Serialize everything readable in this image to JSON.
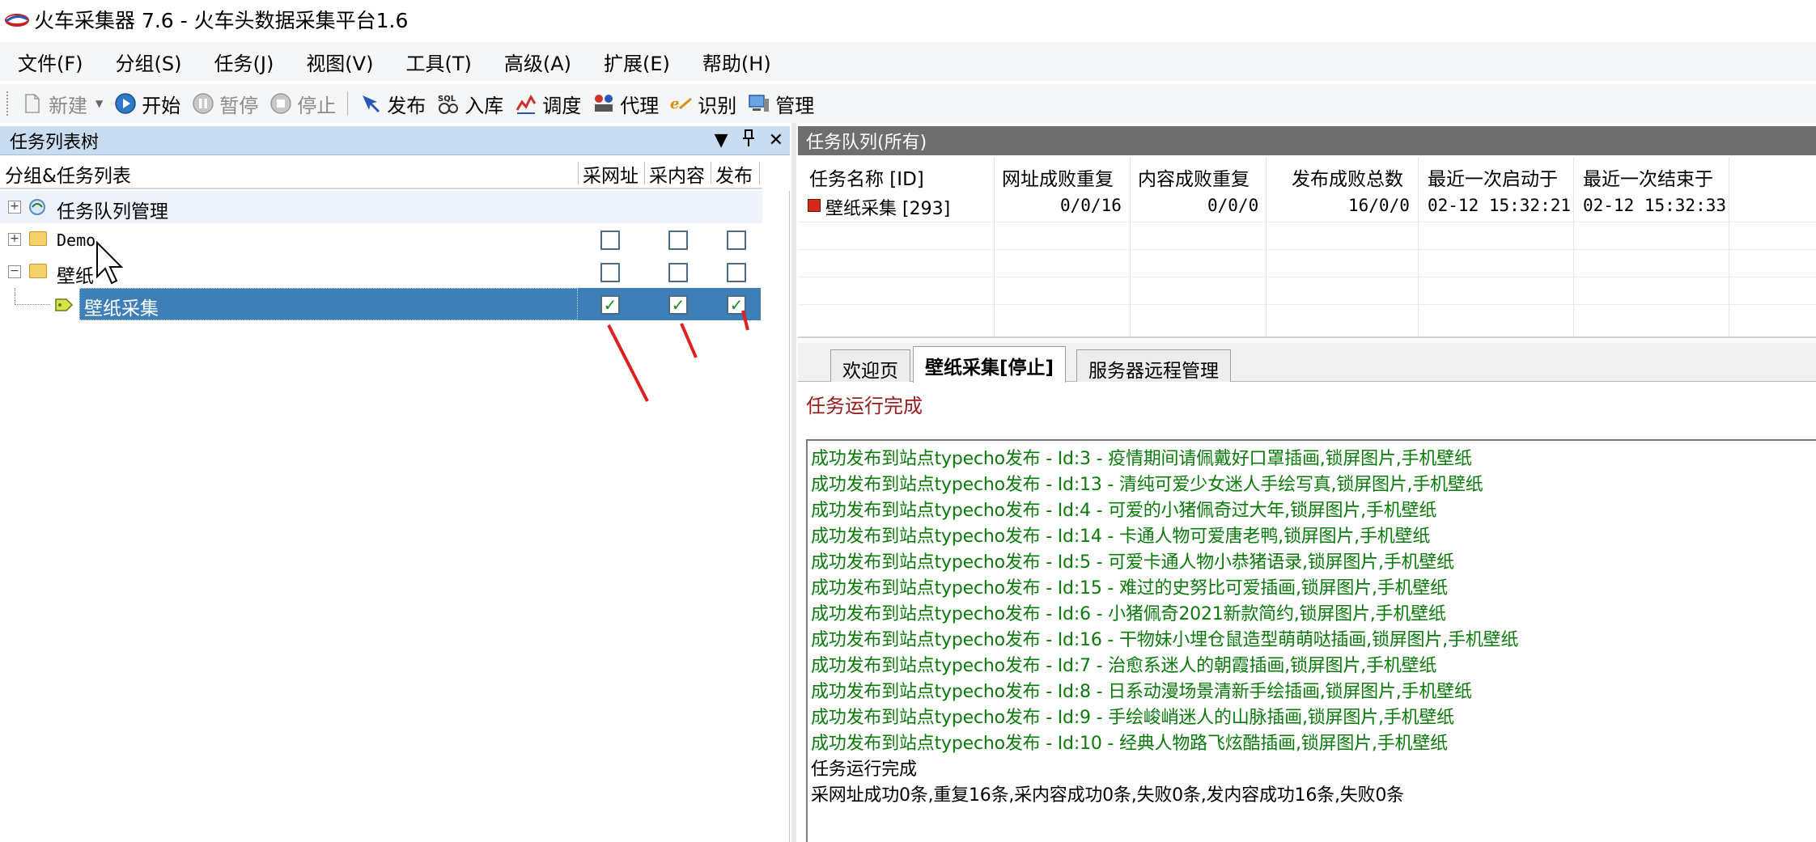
{
  "window": {
    "title": "火车采集器 7.6 - 火车头数据采集平台1.6"
  },
  "menubar": {
    "items": [
      "文件(F)",
      "分组(S)",
      "任务(J)",
      "视图(V)",
      "工具(T)",
      "高级(A)",
      "扩展(E)",
      "帮助(H)"
    ]
  },
  "toolbar": {
    "new_label": "新建",
    "start_label": "开始",
    "pause_label": "暂停",
    "stop_label": "停止",
    "publish_label": "发布",
    "sql_label": "入库",
    "schedule_label": "调度",
    "proxy_label": "代理",
    "recognize_label": "识别",
    "manage_label": "管理"
  },
  "left_panel": {
    "title": "任务列表树",
    "columns": {
      "name": "分组&任务列表",
      "collect_url": "采网址",
      "collect_content": "采内容",
      "publish": "发布"
    },
    "rows": [
      {
        "label": "任务队列管理",
        "checkboxes": null
      },
      {
        "label": "Demo",
        "checkboxes": [
          false,
          false,
          false
        ]
      },
      {
        "label": "壁纸",
        "checkboxes": [
          false,
          false,
          false
        ]
      },
      {
        "label": "壁纸采集",
        "checkboxes": [
          true,
          true,
          true
        ],
        "selected": true
      }
    ]
  },
  "right_panel": {
    "title": "任务队列(所有)",
    "queue_columns": [
      "任务名称 [ID]",
      "网址成败重复",
      "内容成败重复",
      "发布成败总数",
      "最近一次启动于",
      "最近一次结束于"
    ],
    "queue_rows": [
      {
        "name": "壁纸采集 [293]",
        "url_stats": "0/0/16",
        "content_stats": "0/0/0",
        "publish_stats": "16/0/0",
        "last_start": "02-12 15:32:21",
        "last_end": "02-12 15:32:33"
      }
    ],
    "tabs": [
      "欢迎页",
      "壁纸采集[停止]",
      "服务器远程管理"
    ],
    "active_tab": 1,
    "status": "任务运行完成",
    "log_lines": [
      {
        "text": "成功发布到站点typecho发布 - Id:3 - 疫情期间请佩戴好口罩插画,锁屏图片,手机壁纸",
        "color": "green"
      },
      {
        "text": "成功发布到站点typecho发布 - Id:13 - 清纯可爱少女迷人手绘写真,锁屏图片,手机壁纸",
        "color": "green"
      },
      {
        "text": "成功发布到站点typecho发布 - Id:4 - 可爱的小猪佩奇过大年,锁屏图片,手机壁纸",
        "color": "green"
      },
      {
        "text": "成功发布到站点typecho发布 - Id:14 - 卡通人物可爱唐老鸭,锁屏图片,手机壁纸",
        "color": "green"
      },
      {
        "text": "成功发布到站点typecho发布 - Id:5 - 可爱卡通人物小恭猪语录,锁屏图片,手机壁纸",
        "color": "green"
      },
      {
        "text": "成功发布到站点typecho发布 - Id:15 - 难过的史努比可爱插画,锁屏图片,手机壁纸",
        "color": "green"
      },
      {
        "text": "成功发布到站点typecho发布 - Id:6 - 小猪佩奇2021新款简约,锁屏图片,手机壁纸",
        "color": "green"
      },
      {
        "text": "成功发布到站点typecho发布 - Id:16 - 干物妹小埋仓鼠造型萌萌哒插画,锁屏图片,手机壁纸",
        "color": "green"
      },
      {
        "text": "成功发布到站点typecho发布 - Id:7 - 治愈系迷人的朝霞插画,锁屏图片,手机壁纸",
        "color": "green"
      },
      {
        "text": "成功发布到站点typecho发布 - Id:8 - 日系动漫场景清新手绘插画,锁屏图片,手机壁纸",
        "color": "green"
      },
      {
        "text": "成功发布到站点typecho发布 - Id:9 - 手绘峻峭迷人的山脉插画,锁屏图片,手机壁纸",
        "color": "green"
      },
      {
        "text": "成功发布到站点typecho发布 - Id:10 - 经典人物路飞炫酷插画,锁屏图片,手机壁纸",
        "color": "green"
      },
      {
        "text": "任务运行完成",
        "color": "black"
      },
      {
        "text": "采网址成功0条,重复16条,采内容成功0条,失败0条,发内容成功16条,失败0条",
        "color": "black"
      }
    ]
  },
  "colors": {
    "left_header_bg": "#c9dcf0",
    "right_header_bg": "#6f6f6f",
    "selected_row_bg": "#3f7fb8",
    "log_green": "#0a7a0a",
    "status_red": "#9a1b1b",
    "annotation_arrow": "#e02020"
  },
  "icons": {
    "app": "train-logo-icon",
    "new": "document-icon",
    "start": "play-icon",
    "pause": "pause-icon",
    "stop": "stop-icon",
    "publish": "publish-arrow-icon",
    "sql": "sql-database-icon",
    "schedule": "schedule-icon",
    "proxy": "proxy-icon",
    "recognize": "recognize-icon",
    "manage": "monitor-icon"
  }
}
